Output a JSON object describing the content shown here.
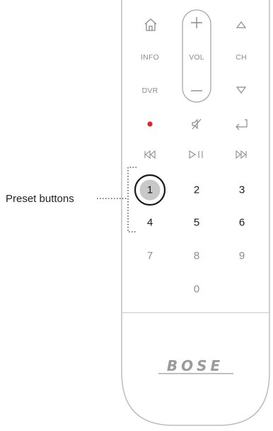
{
  "remote": {
    "vol_label": "VOL",
    "row2": {
      "left_label": "INFO",
      "right_label": "CH"
    },
    "row3": {
      "left_label": "DVR"
    },
    "presets": [
      "1",
      "2",
      "3",
      "4",
      "5",
      "6"
    ],
    "numbers": [
      "7",
      "8",
      "9",
      "0"
    ],
    "brand": "BOSE"
  },
  "callout": {
    "label": "Preset buttons"
  },
  "icons": {
    "home": "home-icon",
    "plus": "plus-icon",
    "minus": "minus-icon",
    "ch_up": "channel-up-icon",
    "ch_down": "channel-down-icon",
    "record": "record-icon",
    "mute": "mute-icon",
    "return": "return-icon",
    "prev": "skip-back-icon",
    "play_pause": "play-pause-icon",
    "next": "skip-forward-icon"
  },
  "colors": {
    "record": "#e3232b",
    "highlight": "#c8c8c8",
    "body_outline": "#bdbdbd"
  }
}
